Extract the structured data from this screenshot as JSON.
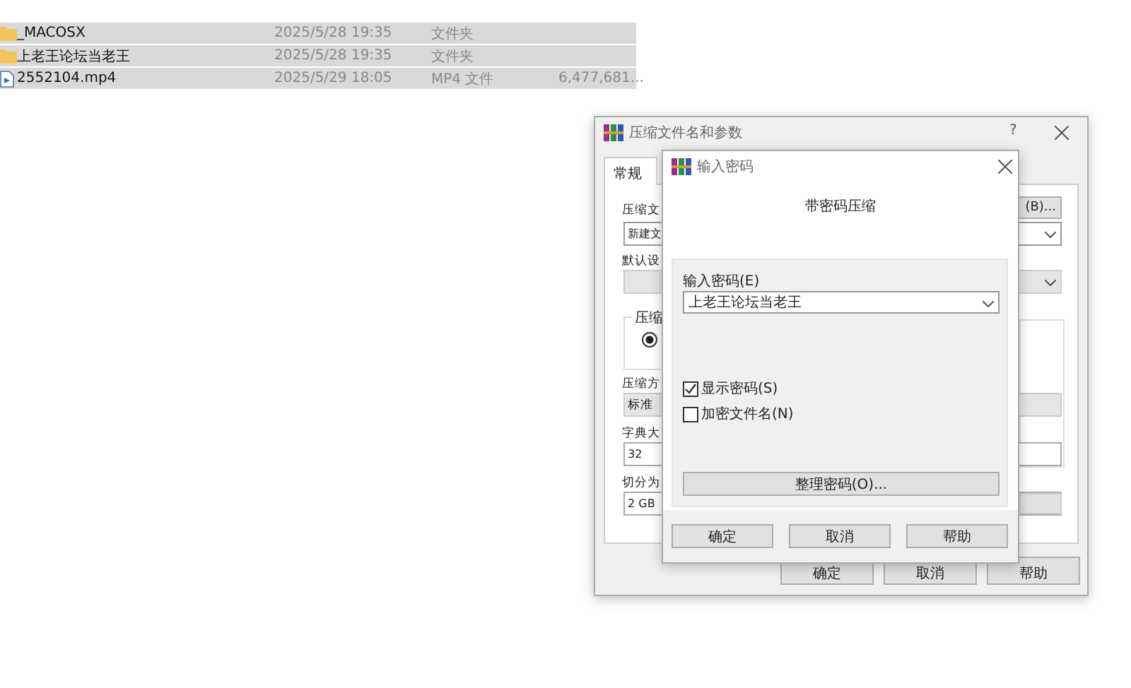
{
  "file_list": {
    "rows": [
      {
        "kind": "folder",
        "name": "_MACOSX",
        "modified": "2025/5/28 19:35",
        "type": "文件夹",
        "size": "",
        "selected": true
      },
      {
        "kind": "folder",
        "name": "上老王论坛当老王",
        "modified": "2025/5/28 19:35",
        "type": "文件夹",
        "size": "",
        "selected": true
      },
      {
        "kind": "video",
        "name": "2552104.mp4",
        "modified": "2025/5/29 18:05",
        "type": "MP4 文件",
        "size": "6,477,681...",
        "selected": true
      }
    ]
  },
  "archive_dialog": {
    "title": "压缩文件名和参数",
    "help": "?",
    "tabs": [
      {
        "label": "常规",
        "selected": true
      }
    ],
    "archive_name_label": "压缩文",
    "browse_button": "(B)...",
    "archive_name_value": "新建文",
    "profile_label": "默认设",
    "format_group_label": "压缩",
    "format_radio_selected": true,
    "method_label": "压缩方",
    "method_value": "标准",
    "dictionary_label": "字典大",
    "dictionary_value": "32",
    "split_label": "切分为",
    "split_value": "2 GB",
    "buttons": [
      "确定",
      "取消",
      "帮助"
    ]
  },
  "password_dialog": {
    "title": "输入密码",
    "heading": "带密码压缩",
    "password_label": "输入密码(E)",
    "password_value": "上老王论坛当老王",
    "options": [
      {
        "label": "显示密码(S)",
        "checked": true
      },
      {
        "label": "加密文件名(N)",
        "checked": false
      }
    ],
    "organize_button": "整理密码(O)...",
    "buttons": [
      "确定",
      "取消",
      "帮助"
    ]
  }
}
